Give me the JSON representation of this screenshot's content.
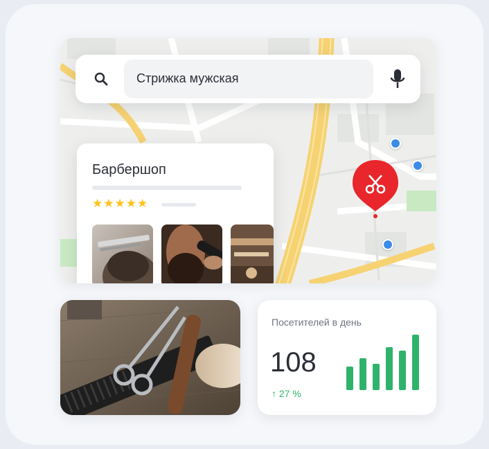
{
  "search": {
    "query": "Стрижка мужская",
    "search_icon": "search-icon",
    "mic_icon": "microphone-icon"
  },
  "business_card": {
    "name": "Барбершоп",
    "rating_stars": "★★★★★",
    "rating": 5,
    "photos": [
      "haircut-photo",
      "beard-trim-photo",
      "barber-tools-photo"
    ]
  },
  "map": {
    "pin_icon": "scissors-icon",
    "pin_color": "#e8262b",
    "poi_color": "#3b8ce8"
  },
  "stats": {
    "label": "Посетителей в день",
    "value": "108",
    "trend": "↑ 27 %",
    "bar_color": "#2fb36b",
    "bars": [
      0.42,
      0.58,
      0.47,
      0.78,
      0.71,
      1.0
    ]
  }
}
